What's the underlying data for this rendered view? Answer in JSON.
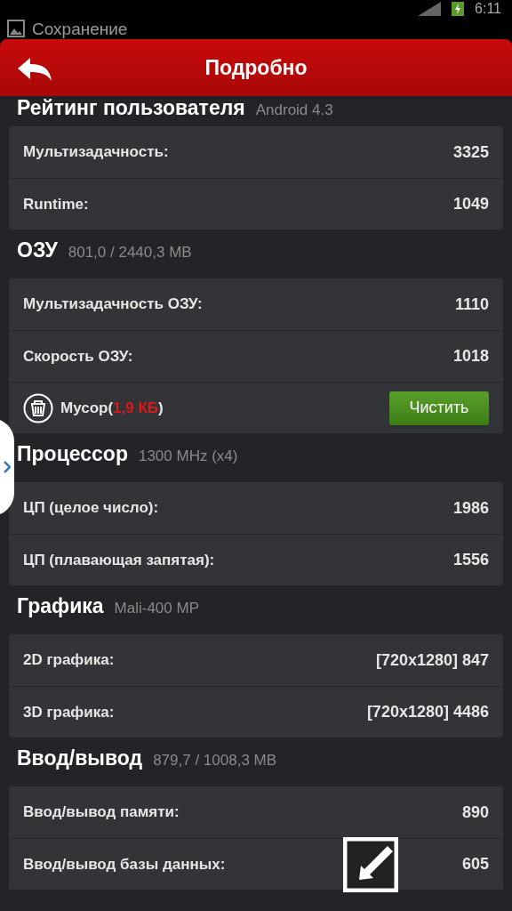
{
  "status_bar": {
    "time": "6:11"
  },
  "notification": {
    "title": "Сохранение"
  },
  "header": {
    "title": "Подробно"
  },
  "sections": [
    {
      "title": "Рейтинг пользователя",
      "subtitle": "Android 4.3",
      "rows": [
        {
          "kind": "score",
          "label": "Мультизадачность:",
          "value": "3325"
        },
        {
          "kind": "score",
          "label": "Runtime:",
          "value": "1049"
        }
      ]
    },
    {
      "title": "ОЗУ",
      "subtitle": "801,0 / 2440,3 MB",
      "rows": [
        {
          "kind": "score",
          "label": "Мультизадачность ОЗУ:",
          "value": "1110"
        },
        {
          "kind": "score",
          "label": "Скорость ОЗУ:",
          "value": "1018"
        },
        {
          "kind": "cleanup",
          "label": "Мусор(**1,9 КБ**)",
          "button": "Чистить"
        }
      ]
    },
    {
      "title": "Процессор",
      "subtitle": "1300 MHz (x4)",
      "rows": [
        {
          "kind": "score",
          "label": "ЦП (целое число):",
          "value": "1986"
        },
        {
          "kind": "score",
          "label": "ЦП (плавающая запятая):",
          "value": "1556"
        }
      ]
    },
    {
      "title": "Графика",
      "subtitle": "Mali-400 MP",
      "rows": [
        {
          "kind": "score",
          "label": "2D графика:",
          "value": "[720x1280] 847"
        },
        {
          "kind": "score",
          "label": "3D графика:",
          "value": "[720x1280] 4486"
        }
      ]
    },
    {
      "title": "Ввод/вывод",
      "subtitle": "879,7 / 1008,3 MB",
      "rows": [
        {
          "kind": "score",
          "label": "Ввод/вывод памяти:",
          "value": "890"
        },
        {
          "kind": "score",
          "label": "Ввод/вывод базы данных:",
          "value": "605"
        }
      ]
    }
  ]
}
